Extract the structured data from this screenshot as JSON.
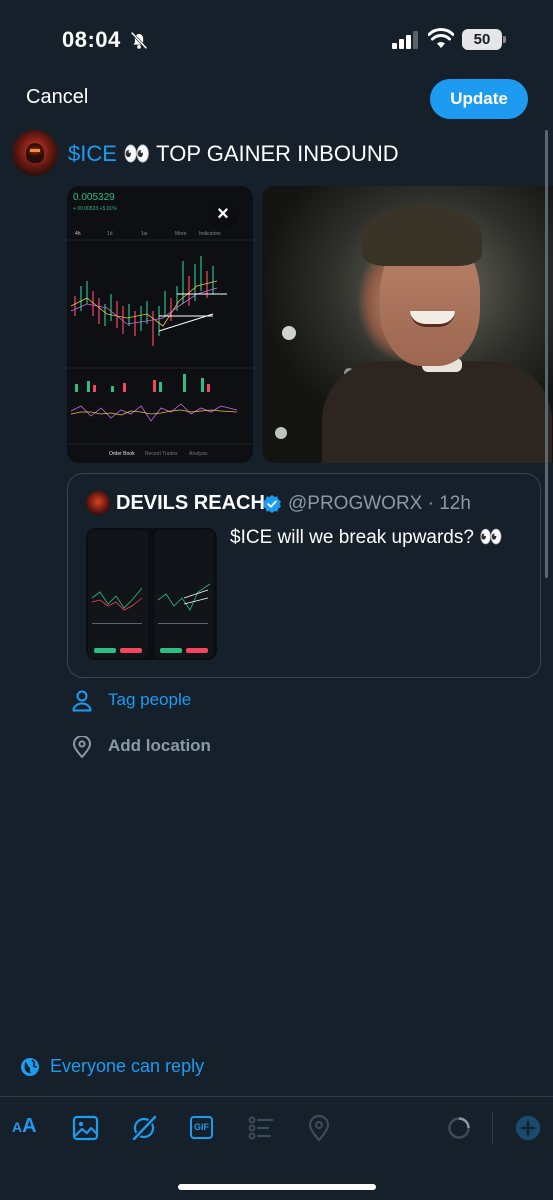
{
  "status_bar": {
    "time": "08:04",
    "battery": "50",
    "icons": [
      "bell-off-icon",
      "cellular-signal-icon",
      "wifi-icon",
      "battery-icon"
    ]
  },
  "header": {
    "cancel_label": "Cancel",
    "update_label": "Update"
  },
  "composer": {
    "cashtag": "$ICE",
    "emoji": "👀",
    "text": "TOP GAINER INBOUND"
  },
  "media": {
    "chart_price": "0.005329",
    "chart_change": "+ 00.00533 +5.01%",
    "chart_tabs": [
      "4h",
      "1d",
      "1w",
      "More",
      "Indicators"
    ],
    "chart_bottom_tabs": [
      "Order Book",
      "Recent Trades",
      "Analysis"
    ]
  },
  "quote": {
    "name": "DEVILS REACH",
    "handle": "@PROGWORX · 12h",
    "text": "$ICE will we break upwards? 👀"
  },
  "options": {
    "tag_people": "Tag people",
    "add_location": "Add location"
  },
  "reply_setting": "Everyone can reply",
  "toolbar": {
    "text_size_small": "A",
    "text_size_large": "A",
    "gif_label": "GIF"
  },
  "colors": {
    "background": "#15202b",
    "accent": "#1d9bf0",
    "muted": "#8b98a5",
    "border": "#38444d"
  }
}
